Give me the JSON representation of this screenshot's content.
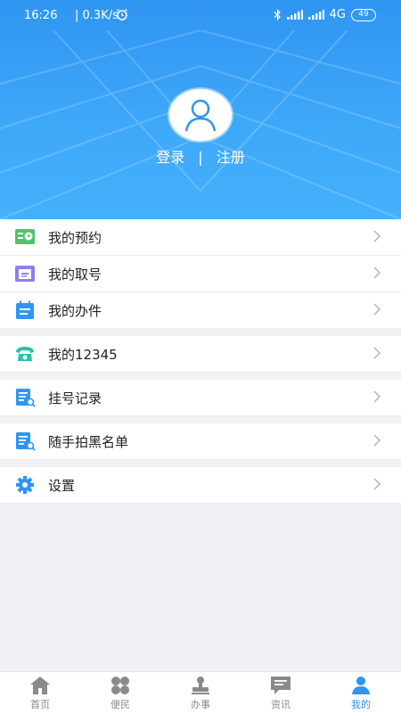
{
  "status_bar": {
    "time": "16:26",
    "speed": "0.3K/s",
    "network": "4G",
    "battery": "49"
  },
  "profile": {
    "login_label": "登录",
    "separator": "|",
    "register_label": "注册"
  },
  "menu": {
    "appointment": "我的预约",
    "queue_number": "我的取号",
    "my_affairs": "我的办件",
    "hotline_12345": "我的12345",
    "registration_records": "挂号记录",
    "blacklist": "随手拍黑名单",
    "settings": "设置"
  },
  "tabbar": {
    "home": "首页",
    "convenience": "便民",
    "affairs": "办事",
    "news": "资讯",
    "mine": "我的"
  },
  "colors": {
    "accent": "#2f95f2",
    "header_top": "#2f95f2",
    "header_bottom": "#44b0fb"
  }
}
